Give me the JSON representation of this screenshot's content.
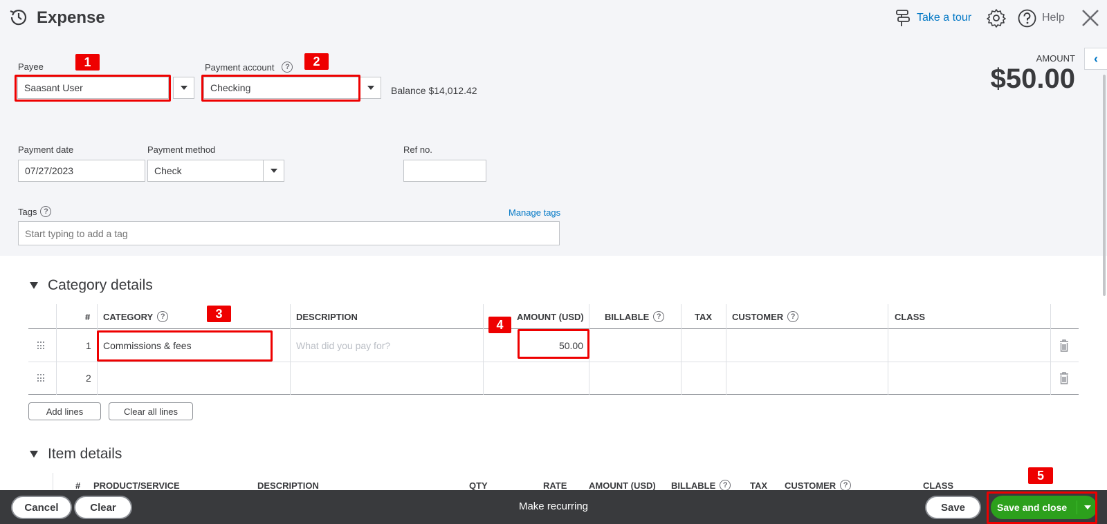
{
  "header": {
    "title": "Expense",
    "take_tour": "Take a tour",
    "help": "Help"
  },
  "form": {
    "payee_label": "Payee",
    "payee_value": "Saasant User",
    "payment_account_label": "Payment account",
    "payment_account_value": "Checking",
    "balance_text": "Balance $14,012.42",
    "amount_label": "AMOUNT",
    "amount_value": "$50.00",
    "payment_date_label": "Payment date",
    "payment_date_value": "07/27/2023",
    "payment_method_label": "Payment method",
    "payment_method_value": "Check",
    "ref_no_label": "Ref no.",
    "ref_no_value": "",
    "tags_label": "Tags",
    "manage_tags": "Manage tags",
    "tags_placeholder": "Start typing to add a tag"
  },
  "category_details": {
    "title": "Category details",
    "columns": [
      "#",
      "CATEGORY",
      "DESCRIPTION",
      "AMOUNT (USD)",
      "BILLABLE",
      "TAX",
      "CUSTOMER",
      "CLASS"
    ],
    "rows": [
      {
        "num": "1",
        "category": "Commissions & fees",
        "description_placeholder": "What did you pay for?",
        "amount": "50.00"
      },
      {
        "num": "2",
        "category": "",
        "description_placeholder": "",
        "amount": ""
      }
    ],
    "add_lines": "Add lines",
    "clear_all_lines": "Clear all lines"
  },
  "item_details": {
    "title": "Item details",
    "columns": [
      "#",
      "PRODUCT/SERVICE",
      "DESCRIPTION",
      "QTY",
      "RATE",
      "AMOUNT (USD)",
      "BILLABLE",
      "TAX",
      "CUSTOMER",
      "CLASS"
    ]
  },
  "footer": {
    "cancel": "Cancel",
    "clear": "Clear",
    "make_recurring": "Make recurring",
    "save": "Save",
    "save_and_close": "Save and close"
  },
  "annotations": [
    "1",
    "2",
    "3",
    "4",
    "5"
  ],
  "colors": {
    "accent_blue": "#0077c5",
    "primary_green": "#2ca01c",
    "highlight_red": "#ee0000",
    "footer_bg": "#393a3d"
  }
}
